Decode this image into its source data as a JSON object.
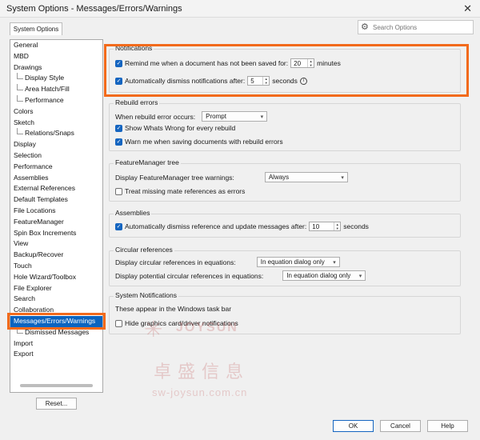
{
  "window": {
    "title": "System Options - Messages/Errors/Warnings",
    "close_glyph": "✕"
  },
  "tab": {
    "label": "System Options"
  },
  "search": {
    "placeholder": "Search Options"
  },
  "tree": {
    "items": [
      {
        "label": "General",
        "level": 0,
        "selected": false
      },
      {
        "label": "MBD",
        "level": 0,
        "selected": false
      },
      {
        "label": "Drawings",
        "level": 0,
        "selected": false
      },
      {
        "label": "Display Style",
        "level": 1,
        "selected": false
      },
      {
        "label": "Area Hatch/Fill",
        "level": 1,
        "selected": false
      },
      {
        "label": "Performance",
        "level": 1,
        "selected": false
      },
      {
        "label": "Colors",
        "level": 0,
        "selected": false
      },
      {
        "label": "Sketch",
        "level": 0,
        "selected": false
      },
      {
        "label": "Relations/Snaps",
        "level": 1,
        "selected": false
      },
      {
        "label": "Display",
        "level": 0,
        "selected": false
      },
      {
        "label": "Selection",
        "level": 0,
        "selected": false
      },
      {
        "label": "Performance",
        "level": 0,
        "selected": false
      },
      {
        "label": "Assemblies",
        "level": 0,
        "selected": false
      },
      {
        "label": "External References",
        "level": 0,
        "selected": false
      },
      {
        "label": "Default Templates",
        "level": 0,
        "selected": false
      },
      {
        "label": "File Locations",
        "level": 0,
        "selected": false
      },
      {
        "label": "FeatureManager",
        "level": 0,
        "selected": false
      },
      {
        "label": "Spin Box Increments",
        "level": 0,
        "selected": false
      },
      {
        "label": "View",
        "level": 0,
        "selected": false
      },
      {
        "label": "Backup/Recover",
        "level": 0,
        "selected": false
      },
      {
        "label": "Touch",
        "level": 0,
        "selected": false
      },
      {
        "label": "Hole Wizard/Toolbox",
        "level": 0,
        "selected": false
      },
      {
        "label": "File Explorer",
        "level": 0,
        "selected": false
      },
      {
        "label": "Search",
        "level": 0,
        "selected": false
      },
      {
        "label": "Collaboration",
        "level": 0,
        "selected": false
      },
      {
        "label": "Messages/Errors/Warnings",
        "level": 0,
        "selected": true
      },
      {
        "label": "Dismissed Messages",
        "level": 1,
        "selected": false
      },
      {
        "label": "Import",
        "level": 0,
        "selected": false
      },
      {
        "label": "Export",
        "level": 0,
        "selected": false
      }
    ]
  },
  "reset_label": "Reset...",
  "notifications": {
    "title": "Notifications",
    "remind_label": "Remind me when a document has not been saved for:",
    "remind_value": "20",
    "remind_unit": "minutes",
    "remind_checked": true,
    "dismiss_label": "Automatically dismiss notifications after:",
    "dismiss_value": "5",
    "dismiss_unit": "seconds",
    "dismiss_checked": true
  },
  "rebuild": {
    "title": "Rebuild errors",
    "when_label": "When rebuild error occurs:",
    "when_value": "Prompt",
    "show_label": "Show Whats Wrong for every rebuild",
    "show_checked": true,
    "warn_label": "Warn me when saving documents with rebuild errors",
    "warn_checked": true
  },
  "featuremanager": {
    "title": "FeatureManager tree",
    "display_label": "Display FeatureManager tree warnings:",
    "display_value": "Always",
    "treat_label": "Treat missing mate references as errors",
    "treat_checked": false
  },
  "assemblies": {
    "title": "Assemblies",
    "dismiss_label": "Automatically dismiss reference and update messages after:",
    "dismiss_value": "10",
    "dismiss_unit": "seconds",
    "dismiss_checked": true
  },
  "circular": {
    "title": "Circular references",
    "display_label": "Display circular references in equations:",
    "display_value": "In equation dialog only",
    "potential_label": "Display potential circular references in equations:",
    "potential_value": "In equation dialog only"
  },
  "system_notifications": {
    "title": "System Notifications",
    "desc": "These appear in the Windows task bar",
    "hide_label": "Hide graphics card/driver notifications",
    "hide_checked": false
  },
  "buttons": {
    "ok": "OK",
    "cancel": "Cancel",
    "help": "Help"
  },
  "watermark": {
    "brand": "JOYSUN",
    "cn": "卓盛信息",
    "url": "sw-joysun.com.cn"
  },
  "colors": {
    "accent": "#1565c0",
    "selection": "#0b64c0",
    "highlight": "#f26a1b"
  }
}
